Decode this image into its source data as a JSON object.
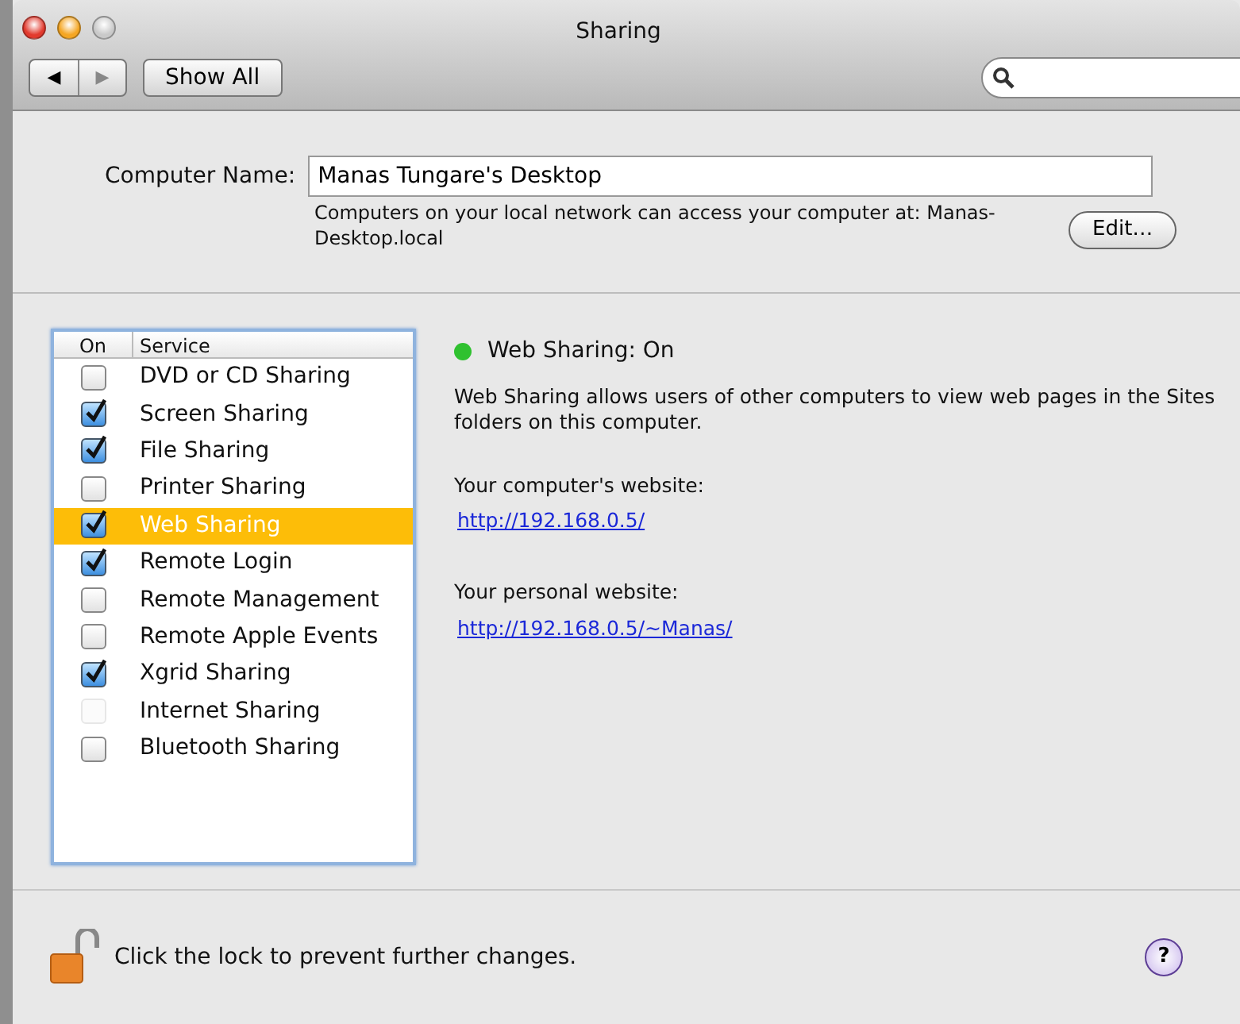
{
  "window": {
    "title": "Sharing"
  },
  "toolbar": {
    "back": "◀",
    "forward": "▶",
    "show_all": "Show All"
  },
  "computer_name": {
    "label": "Computer Name:",
    "value": "Manas Tungare's Desktop",
    "note": "Computers on your local network can access your computer at: Manas-Desktop.local",
    "edit": "Edit…"
  },
  "services": {
    "columns": [
      "On",
      "Service"
    ],
    "rows": [
      {
        "name": "DVD or CD Sharing",
        "checked": false,
        "selected": false,
        "disabled": false
      },
      {
        "name": "Screen Sharing",
        "checked": true,
        "selected": false,
        "disabled": false
      },
      {
        "name": "File Sharing",
        "checked": true,
        "selected": false,
        "disabled": false
      },
      {
        "name": "Printer Sharing",
        "checked": false,
        "selected": false,
        "disabled": false
      },
      {
        "name": "Web Sharing",
        "checked": true,
        "selected": true,
        "disabled": false
      },
      {
        "name": "Remote Login",
        "checked": true,
        "selected": false,
        "disabled": false
      },
      {
        "name": "Remote Management",
        "checked": false,
        "selected": false,
        "disabled": false
      },
      {
        "name": "Remote Apple Events",
        "checked": false,
        "selected": false,
        "disabled": false
      },
      {
        "name": "Xgrid Sharing",
        "checked": true,
        "selected": false,
        "disabled": false
      },
      {
        "name": "Internet Sharing",
        "checked": false,
        "selected": false,
        "disabled": true
      },
      {
        "name": "Bluetooth Sharing",
        "checked": false,
        "selected": false,
        "disabled": false
      }
    ]
  },
  "detail": {
    "status": "Web Sharing: On",
    "on": true,
    "description": "Web Sharing allows users of other computers to view web pages in the Sites folders on this computer.",
    "links": [
      {
        "label": "Your computer's website:",
        "url": "http://192.168.0.5/"
      },
      {
        "label": "Your personal website:",
        "url": "http://192.168.0.5/~Manas/"
      }
    ]
  },
  "footer": {
    "lock_text": "Click the lock to prevent further changes.",
    "help": "?"
  }
}
